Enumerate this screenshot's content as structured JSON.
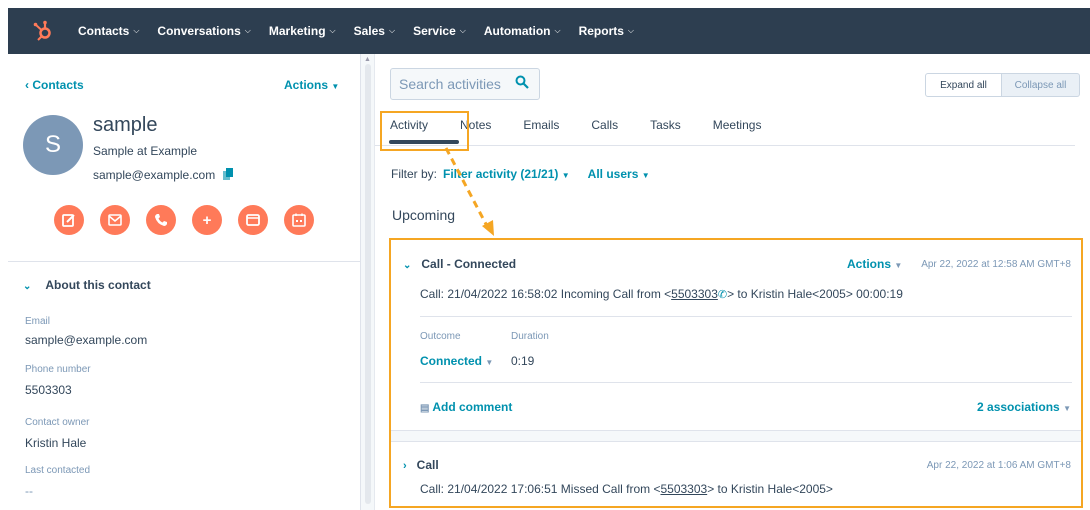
{
  "nav": {
    "items": [
      {
        "label": "Contacts"
      },
      {
        "label": "Conversations"
      },
      {
        "label": "Marketing"
      },
      {
        "label": "Sales"
      },
      {
        "label": "Service"
      },
      {
        "label": "Automation"
      },
      {
        "label": "Reports"
      }
    ],
    "brand_color": "#ff7a59",
    "bar_color": "#2d3e50"
  },
  "left": {
    "back_label": "Contacts",
    "actions_label": "Actions",
    "avatar_letter": "S",
    "contact_name": "sample",
    "company": "Sample at Example",
    "email": "sample@example.com",
    "action_buttons": [
      "note-icon",
      "email-icon",
      "call-icon",
      "plus-icon",
      "message-icon",
      "calendar-icon"
    ],
    "about_title": "About this contact",
    "properties": [
      {
        "label": "Email",
        "value": "sample@example.com"
      },
      {
        "label": "Phone number",
        "value": "5503303"
      },
      {
        "label": "Contact owner",
        "value": "Kristin Hale"
      },
      {
        "label": "Last contacted",
        "value": "--"
      }
    ]
  },
  "right": {
    "search_placeholder": "Search activities",
    "expand_all": "Expand all",
    "collapse_all": "Collapse all",
    "tabs": [
      "Activity",
      "Notes",
      "Emails",
      "Calls",
      "Tasks",
      "Meetings"
    ],
    "active_tab": "Activity",
    "filter_label": "Filter by:",
    "filter_activity": "Filter activity (21/21)",
    "filter_users": "All users",
    "section_title": "Upcoming",
    "activities": [
      {
        "title": "Call - Connected",
        "actions_label": "Actions",
        "date": "Apr 22, 2022 at 12:58 AM GMT+8",
        "body_prefix": "Call: 21/04/2022 16:58:02 Incoming Call from <",
        "body_number": "5503303",
        "body_suffix": "> to Kristin Hale<2005> 00:00:19",
        "outcome_label": "Outcome",
        "outcome_value": "Connected",
        "duration_label": "Duration",
        "duration_value": "0:19",
        "add_comment": "Add comment",
        "associations": "2 associations"
      },
      {
        "title": "Call",
        "date": "Apr 22, 2022 at 1:06 AM GMT+8",
        "body_prefix": "Call: 21/04/2022 17:06:51 Missed Call from <",
        "body_number": "5503303",
        "body_suffix": "> to Kristin Hale<2005>"
      }
    ]
  },
  "highlight_color": "#f5a623"
}
